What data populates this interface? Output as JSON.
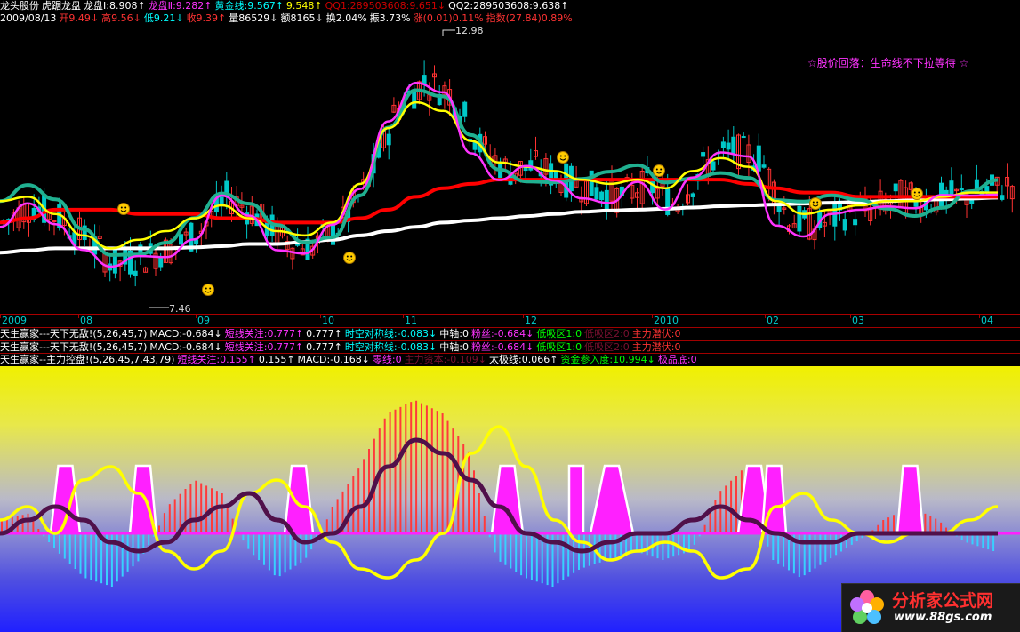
{
  "header": {
    "row1": [
      {
        "text": "龙头股份",
        "cls": "w"
      },
      {
        "text": "虎踞龙盘",
        "cls": "w"
      },
      {
        "text": "龙盘Ⅰ:8.908↑",
        "cls": "w"
      },
      {
        "text": "龙盘Ⅱ:9.282↑",
        "cls": "m"
      },
      {
        "text": "黄金线:9.567↑",
        "cls": "c"
      },
      {
        "text": "9.548↑",
        "cls": "y"
      },
      {
        "text": "QQ1:289503608:9.651↓",
        "cls": "dr"
      },
      {
        "text": "QQ2:289503608:9.638↑",
        "cls": "w"
      }
    ],
    "row2": [
      {
        "text": "2009/08/13",
        "cls": "w"
      },
      {
        "text": "开9.49↓",
        "cls": "r"
      },
      {
        "text": "高9.56↓",
        "cls": "r"
      },
      {
        "text": "低9.21↓",
        "cls": "c"
      },
      {
        "text": "收9.39↑",
        "cls": "r"
      },
      {
        "text": "量86529↓",
        "cls": "w"
      },
      {
        "text": "额8165↓",
        "cls": "w"
      },
      {
        "text": "换2.04%",
        "cls": "w"
      },
      {
        "text": "振3.73%",
        "cls": "w"
      },
      {
        "text": "涨(0.01)0.11%",
        "cls": "r"
      },
      {
        "text": "指数(27.84)0.89%",
        "cls": "r"
      }
    ]
  },
  "indicator_rows": [
    [
      {
        "text": "天生赢家---天下无敌!(5,26,45,7)",
        "cls": "w"
      },
      {
        "text": "MACD:-0.684↓",
        "cls": "w"
      },
      {
        "text": "短线关注:0.777↑",
        "cls": "m"
      },
      {
        "text": "0.777↑",
        "cls": "w"
      },
      {
        "text": "时空对称线:-0.083↓",
        "cls": "c"
      },
      {
        "text": "中轴:0",
        "cls": "w"
      },
      {
        "text": "粉丝:-0.684↓",
        "cls": "m"
      },
      {
        "text": "低吸区1:0",
        "cls": "g"
      },
      {
        "text": "低吸区2:0",
        "cls": "dim"
      },
      {
        "text": "主力潜伏:0",
        "cls": "r"
      }
    ],
    [
      {
        "text": "天生赢家---天下无敌!(5,26,45,7)",
        "cls": "w"
      },
      {
        "text": "MACD:-0.684↓",
        "cls": "w"
      },
      {
        "text": "短线关注:0.777↑",
        "cls": "m"
      },
      {
        "text": "0.777↑",
        "cls": "w"
      },
      {
        "text": "时空对称线:-0.083↓",
        "cls": "c"
      },
      {
        "text": "中轴:0",
        "cls": "w"
      },
      {
        "text": "粉丝:-0.684↓",
        "cls": "m"
      },
      {
        "text": "低吸区1:0",
        "cls": "g"
      },
      {
        "text": "低吸区2:0",
        "cls": "dim"
      },
      {
        "text": "主力潜伏:0",
        "cls": "r"
      }
    ],
    [
      {
        "text": "天生赢家--主力控盘!(5,26,45,7,43,79)",
        "cls": "w"
      },
      {
        "text": "短线关注:0.155↑",
        "cls": "m"
      },
      {
        "text": "0.155↑",
        "cls": "w"
      },
      {
        "text": "MACD:-0.168↓",
        "cls": "w"
      },
      {
        "text": "零线:0",
        "cls": "m"
      },
      {
        "text": "主力资本:-0.109↓",
        "cls": "dim"
      },
      {
        "text": "太极线:0.066↑",
        "cls": "w"
      },
      {
        "text": "资金参入度:10.994↓",
        "cls": "g"
      },
      {
        "text": "极品底:0",
        "cls": "m"
      }
    ]
  ],
  "annotation": "☆股价回落：生命线不下拉等待 ☆",
  "price_labels": {
    "high": "12.98",
    "low": "7.46"
  },
  "date_ticks": [
    "2009",
    "08",
    "09",
    "10",
    "11",
    "12",
    "2010",
    "02",
    "03",
    "04"
  ],
  "watermark": {
    "title": "分析家公式网",
    "url": "www.88gs.com"
  },
  "colors": {
    "up": "#ff3232",
    "down": "#00c8c8",
    "white_line": "#ffffff",
    "red_line": "#ff0000",
    "yellow_line": "#ffff00",
    "magenta_line": "#ff33ff",
    "green_line": "#20b090",
    "purple_line": "#50104a"
  },
  "chart_data": [
    {
      "type": "candlestick",
      "title": "龙头股份",
      "x_range": [
        "2009/07",
        "2010/04"
      ],
      "ylim": [
        7.0,
        13.5
      ],
      "high_marker": 12.98,
      "low_marker": 7.46,
      "series": [
        {
          "name": "龙盘Ⅰ",
          "close_path": [
            9.0,
            9.4,
            9.1,
            8.6,
            8.0,
            8.2,
            8.4,
            8.8,
            9.6,
            9.2,
            8.6,
            8.4,
            8.9,
            9.9,
            11.6,
            12.3,
            12.0,
            10.8,
            10.2,
            10.3,
            10.0,
            9.8,
            9.6,
            9.9,
            9.4,
            10.3,
            10.7,
            10.5,
            9.1,
            8.9,
            9.2,
            9.3,
            9.6,
            9.5,
            9.6,
            9.7,
            9.9
          ]
        },
        {
          "name": "龙盘Ⅱ",
          "values": [
            9.5,
            9.6,
            9.2,
            8.7,
            8.4,
            8.6,
            8.8,
            9.1,
            9.4,
            9.1,
            8.8,
            8.7,
            9.0,
            9.9,
            11.2,
            11.8,
            11.6,
            10.9,
            10.4,
            10.3,
            10.2,
            10.0,
            9.9,
            10.0,
            9.8,
            10.2,
            10.5,
            10.3,
            9.5,
            9.2,
            9.3,
            9.4,
            9.5,
            9.5,
            9.6,
            9.7,
            9.7
          ]
        },
        {
          "name": "黄金线",
          "values": [
            9.0,
            9.1,
            9.3,
            9.3,
            9.3,
            9.2,
            9.2,
            9.2,
            9.1,
            9.1,
            9.0,
            9.0,
            9.0,
            9.1,
            9.3,
            9.6,
            9.8,
            9.9,
            10.0,
            10.0,
            10.0,
            10.0,
            10.0,
            10.0,
            10.0,
            10.0,
            10.0,
            9.9,
            9.8,
            9.7,
            9.7,
            9.6,
            9.6,
            9.6,
            9.6,
            9.6,
            9.6
          ]
        },
        {
          "name": "生命线",
          "values": [
            8.3,
            8.35,
            8.4,
            8.4,
            8.4,
            8.4,
            8.4,
            8.42,
            8.45,
            8.5,
            8.5,
            8.55,
            8.6,
            8.7,
            8.8,
            8.9,
            9.0,
            9.05,
            9.1,
            9.15,
            9.2,
            9.25,
            9.28,
            9.3,
            9.32,
            9.35,
            9.38,
            9.4,
            9.42,
            9.44,
            9.46,
            9.48,
            9.5,
            9.52,
            9.54,
            9.56,
            9.58
          ]
        }
      ]
    },
    {
      "type": "bar",
      "title": "天生赢家--主力控盘",
      "ylim": [
        -1,
        1
      ],
      "series": [
        {
          "name": "MACD",
          "values": [
            0.1,
            0.15,
            -0.2,
            -0.5,
            -0.6,
            -0.3,
            0.2,
            0.4,
            0.3,
            -0.2,
            -0.5,
            -0.3,
            0.2,
            0.5,
            0.9,
            1.0,
            0.9,
            0.6,
            -0.3,
            -0.5,
            -0.6,
            -0.4,
            -0.3,
            -0.2,
            -0.3,
            -0.2,
            0.3,
            0.5,
            -0.3,
            -0.5,
            -0.3,
            -0.1,
            0.1,
            0.2,
            0.1,
            -0.1,
            -0.2
          ]
        },
        {
          "name": "太极线",
          "values": [
            0.0,
            0.1,
            0.2,
            0.1,
            -0.1,
            -0.2,
            -0.1,
            0.1,
            0.2,
            0.3,
            0.1,
            -0.1,
            0.0,
            0.2,
            0.5,
            0.7,
            0.6,
            0.4,
            0.2,
            0.0,
            -0.1,
            -0.2,
            -0.1,
            0.0,
            0.0,
            0.1,
            0.2,
            0.1,
            0.0,
            -0.1,
            -0.1,
            0.0,
            0.0,
            0.0,
            0.0,
            0.0,
            0.0
          ]
        },
        {
          "name": "资金参入度",
          "values": [
            0.1,
            0.2,
            0.0,
            0.4,
            0.5,
            0.3,
            -0.2,
            -0.4,
            -0.2,
            0.3,
            0.4,
            0.2,
            -0.1,
            -0.4,
            -0.5,
            -0.3,
            0.0,
            0.6,
            0.8,
            0.5,
            0.1,
            -0.1,
            -0.3,
            -0.2,
            -0.1,
            -0.2,
            -0.5,
            -0.4,
            0.2,
            0.3,
            0.1,
            0.0,
            -0.1,
            0.0,
            0.0,
            0.1,
            0.2
          ]
        }
      ]
    }
  ]
}
